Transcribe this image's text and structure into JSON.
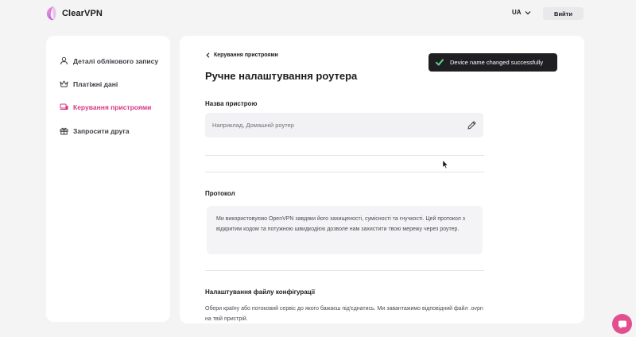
{
  "header": {
    "logo_text": "ClearVPN",
    "language": "UA",
    "logout_label": "Вийти"
  },
  "sidebar": {
    "items": [
      {
        "label": "Деталі облікового запису",
        "icon": "user-icon",
        "active": false
      },
      {
        "label": "Платіжні дані",
        "icon": "crown-icon",
        "active": false
      },
      {
        "label": "Керування пристроями",
        "icon": "devices-icon",
        "active": true
      },
      {
        "label": "Запросити друга",
        "icon": "gift-icon",
        "active": false
      }
    ]
  },
  "main": {
    "breadcrumb": "Керування пристроями",
    "title": "Ручне налаштування роутера",
    "device_name": {
      "label": "Назва пристрою",
      "placeholder": "Наприклад, Домашній роутер",
      "value": ""
    },
    "protocol": {
      "label": "Протокол",
      "text": "Ми використовуємо OpenVPN завдяки його захищеності, сумісності та гнучкості. Цей протокол з відкритим кодом та потужною швидкодією дозволе нам захистити твою мережу через роутер."
    },
    "config": {
      "label": "Налаштування файлу конфігурації",
      "text": "Обери країну або потоковий сервіс до якого бажаєш під'єднатись. Ми завантажимо відповідний файл .ovpn на твій пристрій."
    }
  },
  "toast": {
    "message": "Device name changed successfully",
    "icon": "check-icon"
  },
  "colors": {
    "accent": "#d63583",
    "toast_bg": "#1f1f23",
    "chat_bg": "#e34f8e"
  }
}
